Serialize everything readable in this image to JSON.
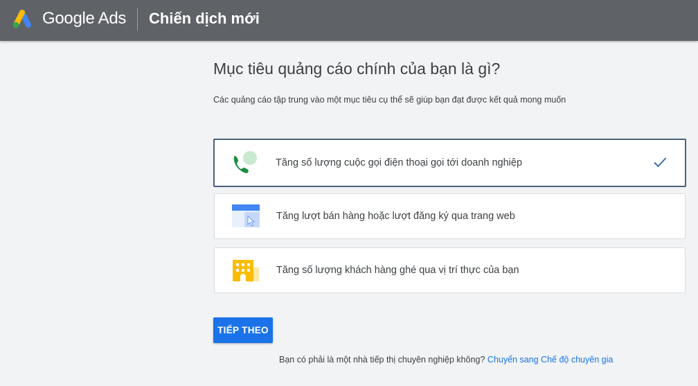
{
  "header": {
    "brand": "Google Ads",
    "title": "Chiến dịch mới",
    "logo_icon": "google-ads-logo-icon",
    "background": "#5f6368"
  },
  "main": {
    "heading": "Mục tiêu quảng cáo chính của bạn là gì?",
    "subheading": "Các quảng cáo tập trung vào một mục tiêu cụ thể sẽ giúp bạn đạt được kết quả mong muốn",
    "goals": [
      {
        "label": "Tăng số lượng cuộc gọi điện thoại gọi tới doanh nghiệp",
        "icon": "phone-call-icon",
        "selected": true
      },
      {
        "label": "Tăng lượt bán hàng hoặc lượt đăng ký qua trang web",
        "icon": "website-icon",
        "selected": false
      },
      {
        "label": "Tăng số lượng khách hàng ghé qua vị trí thực của bạn",
        "icon": "storefront-icon",
        "selected": false
      }
    ],
    "next_button": "TIẾP THEO",
    "expert_prompt": "Bạn có phải là một nhà tiếp thị chuyên nghiệp không?",
    "expert_link": "Chuyển sang Chế độ chuyên gia"
  },
  "colors": {
    "accent": "#1a73e8",
    "selected_border": "#4a5f7a",
    "check": "#3c6ea8"
  }
}
